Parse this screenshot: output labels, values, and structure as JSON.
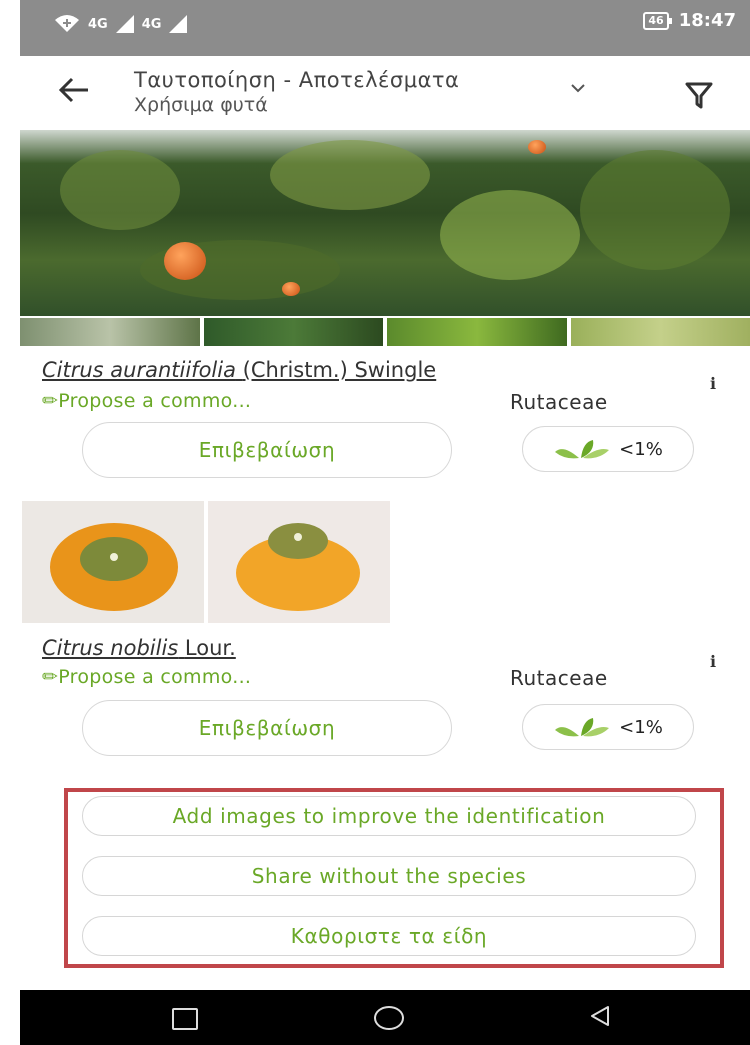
{
  "status": {
    "net1": "4G",
    "net2": "4G",
    "battery": "46",
    "time": "18:47"
  },
  "appbar": {
    "title": "Ταυτοποίηση - Αποτελέσματα",
    "subtitle": "Χρήσιμα φυτά"
  },
  "results": [
    {
      "genus_species": "Citrus aurantiifolia",
      "author": "(Christm.) Swingle",
      "propose": "Propose a commo...",
      "family": "Rutaceae",
      "confirm_label": "Επιβεβαίωση",
      "score": "<1%"
    },
    {
      "genus_species": "Citrus nobilis",
      "author": "Lour.",
      "propose": "Propose a commo...",
      "family": "Rutaceae",
      "confirm_label": "Επιβεβαίωση",
      "score": "<1%"
    }
  ],
  "actions": {
    "add_images": "Add images to improve the identification",
    "share": "Share without the species",
    "specify": "Καθοριστε τα είδη"
  },
  "colors": {
    "accent": "#6aa827",
    "highlight_box": "#c0464a",
    "statusbar": "#8c8c8c"
  },
  "icons": [
    "wifi-icon",
    "signal-icon",
    "battery-icon",
    "back-arrow-icon",
    "chevron-down-icon",
    "filter-icon",
    "info-icon",
    "pencil-icon",
    "leaf-icon",
    "recent-apps-icon",
    "home-icon",
    "nav-back-icon"
  ]
}
